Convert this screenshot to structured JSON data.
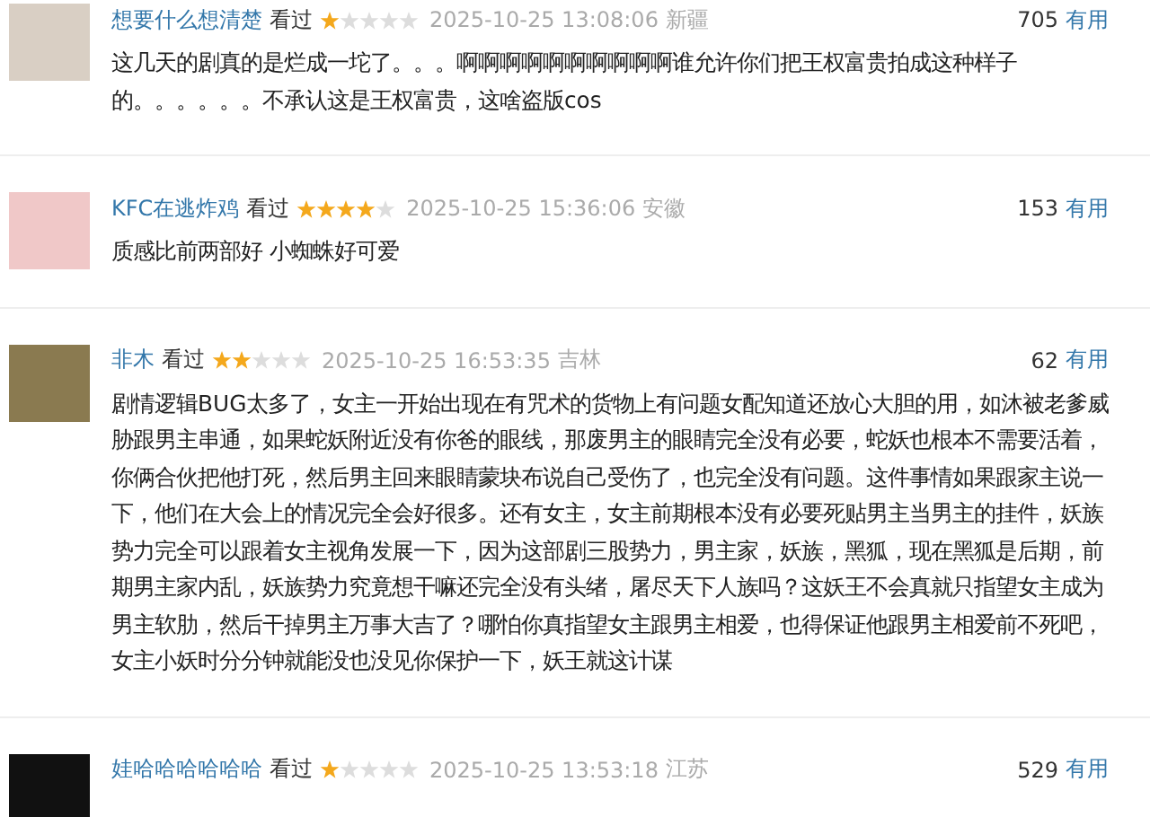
{
  "reviews": [
    {
      "user": "想要什么想清楚",
      "status": "看过",
      "stars": 1,
      "time": "2025-10-25 13:08:06",
      "location": "新疆",
      "votes": "705",
      "vote_label": "有用",
      "text": "这几天的剧真的是烂成一坨了。。。啊啊啊啊啊啊啊啊啊啊谁允许你们把王权富贵拍成这种样子的。。。。。。不承认这是王权富贵，这啥盗版cos"
    },
    {
      "user": "KFC在逃炸鸡",
      "status": "看过",
      "stars": 4,
      "time": "2025-10-25 15:36:06",
      "location": "安徽",
      "votes": "153",
      "vote_label": "有用",
      "text": "质感比前两部好 小蜘蛛好可爱"
    },
    {
      "user": "非木",
      "status": "看过",
      "stars": 2,
      "time": "2025-10-25 16:53:35",
      "location": "吉林",
      "votes": "62",
      "vote_label": "有用",
      "text": "剧情逻辑BUG太多了，女主一开始出现在有咒术的货物上有问题女配知道还放心大胆的用，如沐被老爹威胁跟男主串通，如果蛇妖附近没有你爸的眼线，那废男主的眼睛完全没有必要，蛇妖也根本不需要活着，你俩合伙把他打死，然后男主回来眼睛蒙块布说自己受伤了，也完全没有问题。这件事情如果跟家主说一下，他们在大会上的情况完全会好很多。还有女主，女主前期根本没有必要死贴男主当男主的挂件，妖族势力完全可以跟着女主视角发展一下，因为这部剧三股势力，男主家，妖族，黑狐，现在黑狐是后期，前期男主家内乱，妖族势力究竟想干嘛还完全没有头绪，屠尽天下人族吗？这妖王不会真就只指望女主成为男主软肋，然后干掉男主万事大吉了？哪怕你真指望女主跟男主相爱，也得保证他跟男主相爱前不死吧，女主小妖时分分钟就能没也没见你保护一下，妖王就这计谋"
    },
    {
      "user": "娃哈哈哈哈哈哈",
      "status": "看过",
      "stars": 1,
      "time": "2025-10-25 13:53:18",
      "location": "江苏",
      "votes": "529",
      "vote_label": "有用"
    }
  ]
}
